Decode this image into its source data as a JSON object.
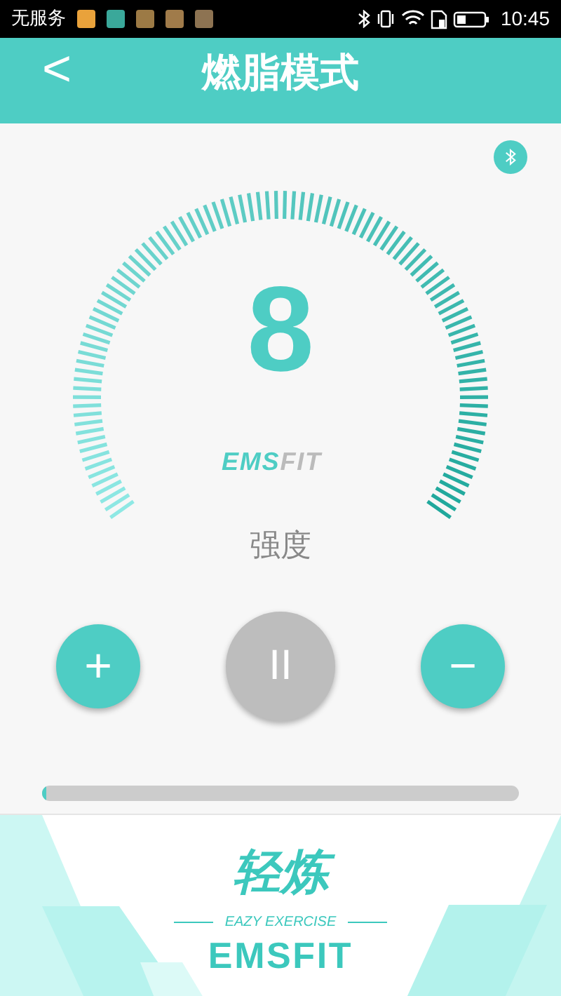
{
  "status_bar": {
    "carrier": "无服务",
    "time": "10:45"
  },
  "header": {
    "back": "<",
    "title": "燃脂模式"
  },
  "bluetooth": {
    "connected": true
  },
  "gauge": {
    "value": "8",
    "logo": {
      "accent": "EMS",
      "plain": "FIT"
    },
    "label": "强度"
  },
  "controls": {
    "increase": "+",
    "pause": "II",
    "decrease": "−"
  },
  "progress": {
    "level": 0.01
  },
  "footer": {
    "logo_cn": "轻炼",
    "tagline": "EAZY EXERCISE",
    "logo_en": "EMSFIT"
  }
}
